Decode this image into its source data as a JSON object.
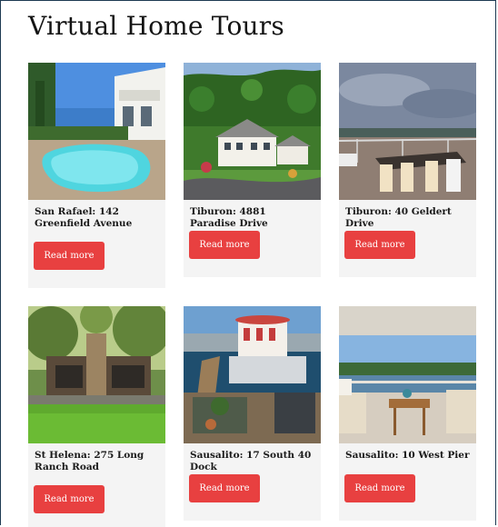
{
  "page_title": "Virtual Home Tours",
  "button_label": "Read more",
  "tours": [
    {
      "title": "San Rafael: 142 Greenfield Avenue",
      "image": "pool-backyard-photo"
    },
    {
      "title": "Tiburon: 4881 Paradise Drive",
      "image": "hillside-house-aerial-photo"
    },
    {
      "title": "Tiburon: 40 Geldert Drive",
      "image": "deck-bay-view-photo"
    },
    {
      "title": "St Helena: 275 Long Ranch Road",
      "image": "lawn-cottage-photo"
    },
    {
      "title": "Sausalito: 17 South 40 Dock",
      "image": "houseboat-dock-photo"
    },
    {
      "title": "Sausalito: 10 West Pier",
      "image": "patio-water-view-photo"
    }
  ],
  "colors": {
    "button": "#e84040",
    "card_background": "#f4f4f4",
    "frame_border": "#1d3a52"
  }
}
